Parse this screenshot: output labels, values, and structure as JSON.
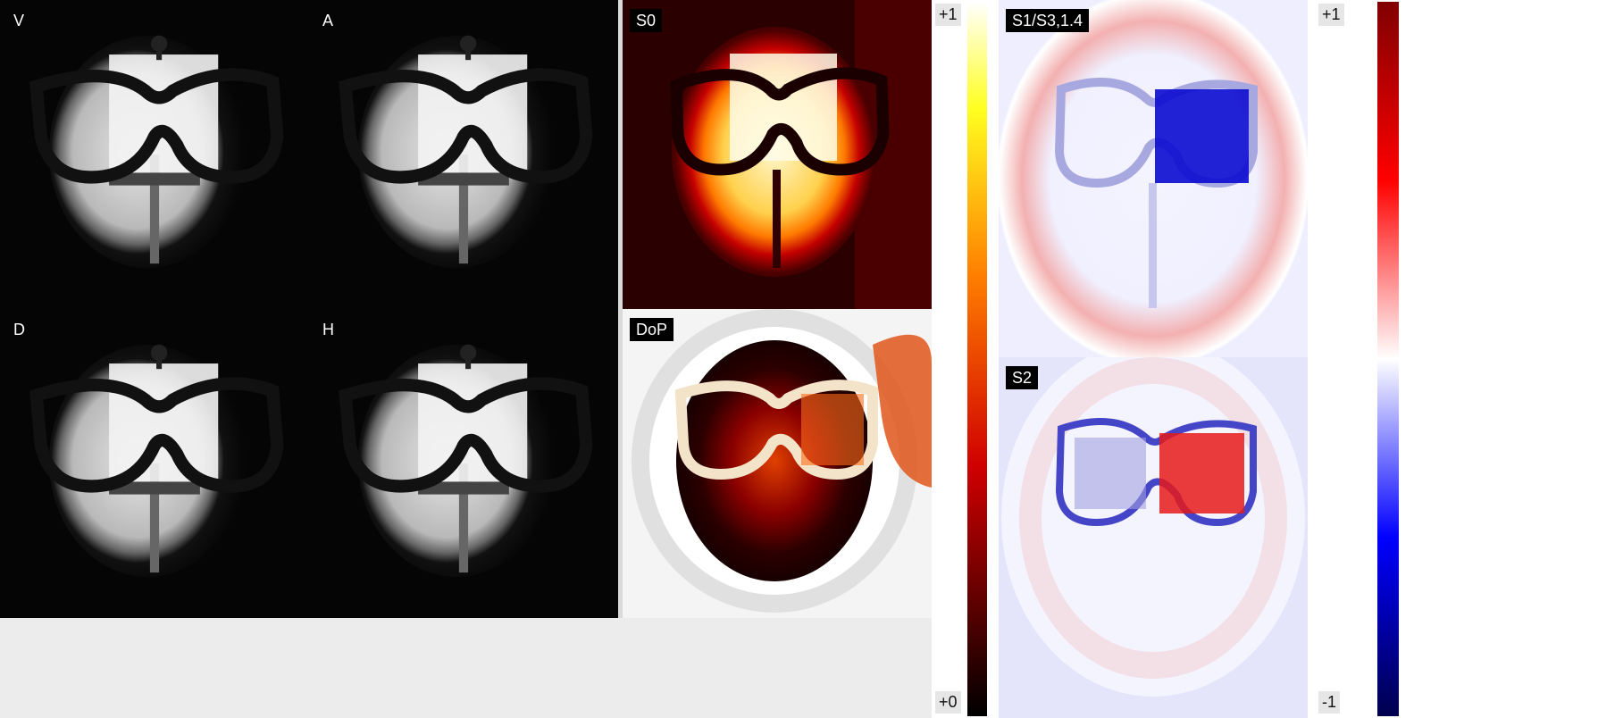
{
  "panels": {
    "v": {
      "label": "V"
    },
    "a": {
      "label": "A"
    },
    "d": {
      "label": "D"
    },
    "h": {
      "label": "H"
    },
    "s0": {
      "label": "S0"
    },
    "dop": {
      "label": "DoP"
    },
    "s1s3": {
      "label": "S1/S3,1.4"
    },
    "s2": {
      "label": "S2"
    }
  },
  "colorbar_heat": {
    "top_label": "+1",
    "bottom_label": "+0",
    "colormap": "hot"
  },
  "colorbar_diverging": {
    "top_label": "+1",
    "bottom_label": "-1",
    "colormap": "seismic"
  }
}
